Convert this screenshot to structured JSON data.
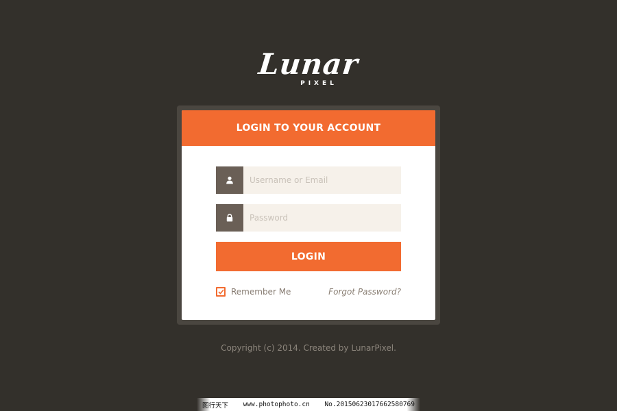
{
  "logo": {
    "name": "Lunar",
    "sub": "PIXEL"
  },
  "login": {
    "header": "LOGIN TO YOUR ACCOUNT",
    "username_placeholder": "Username or Email",
    "password_placeholder": "Password",
    "button_label": "LOGIN",
    "remember_label": "Remember Me",
    "remember_checked": true,
    "forgot_label": "Forgot Password?"
  },
  "icons": {
    "username": "user-icon",
    "password": "lock-icon",
    "remember": "checkmark-icon"
  },
  "colors": {
    "accent": "#f26b30",
    "background": "#33302b",
    "card_frame": "#4a4640",
    "field_icon_bg": "#6a5f56",
    "field_bg": "#f6f1ea"
  },
  "footer": {
    "copyright": "Copyright (c) 2014. Created by LunarPixel."
  },
  "watermark": {
    "site_name": "图行天下",
    "url": "www.photophoto.cn",
    "number": "No.20150623017662580769"
  }
}
